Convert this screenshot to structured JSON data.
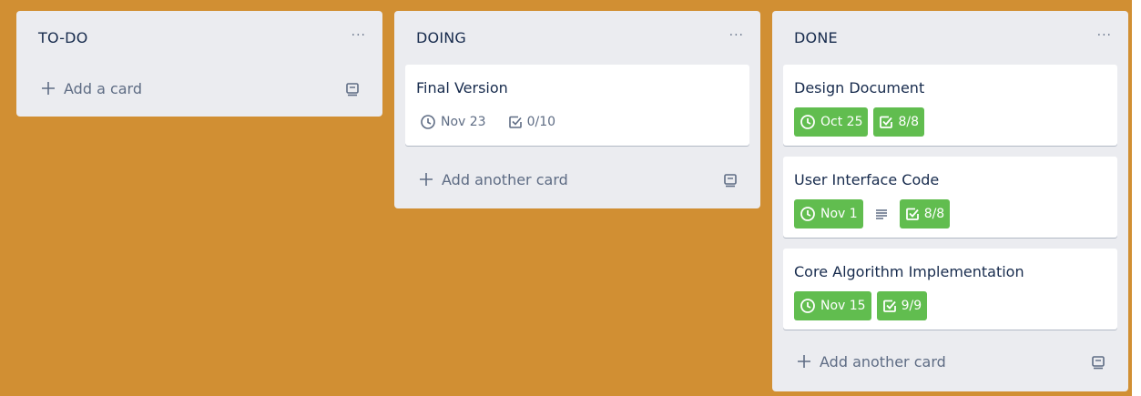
{
  "colors": {
    "board_background": "#d18f33",
    "list_background": "#ebecf0",
    "card_background": "#ffffff",
    "badge_complete": "#61bd4f",
    "muted_text": "#5e6c84",
    "title_text": "#172b4d"
  },
  "icons": {
    "menu": "ellipsis-icon",
    "add": "plus-icon",
    "template": "card-template-icon",
    "due": "clock-icon",
    "checklist": "checklist-icon",
    "description": "description-icon"
  },
  "lists": [
    {
      "title": "TO-DO",
      "menu_label": "···",
      "add_label": "Add a card",
      "cards": []
    },
    {
      "title": "DOING",
      "menu_label": "···",
      "add_label": "Add another card",
      "cards": [
        {
          "title": "Final Version",
          "due": "Nov 23",
          "due_complete": false,
          "checklist": "0/10",
          "checklist_complete": false,
          "has_description": false
        }
      ]
    },
    {
      "title": "DONE",
      "menu_label": "···",
      "add_label": "Add another card",
      "cards": [
        {
          "title": "Design Document",
          "due": "Oct 25",
          "due_complete": true,
          "checklist": "8/8",
          "checklist_complete": true,
          "has_description": false
        },
        {
          "title": "User Interface Code",
          "due": "Nov 1",
          "due_complete": true,
          "checklist": "8/8",
          "checklist_complete": true,
          "has_description": true
        },
        {
          "title": "Core Algorithm Implementation",
          "due": "Nov 15",
          "due_complete": true,
          "checklist": "9/9",
          "checklist_complete": true,
          "has_description": false
        }
      ]
    }
  ]
}
